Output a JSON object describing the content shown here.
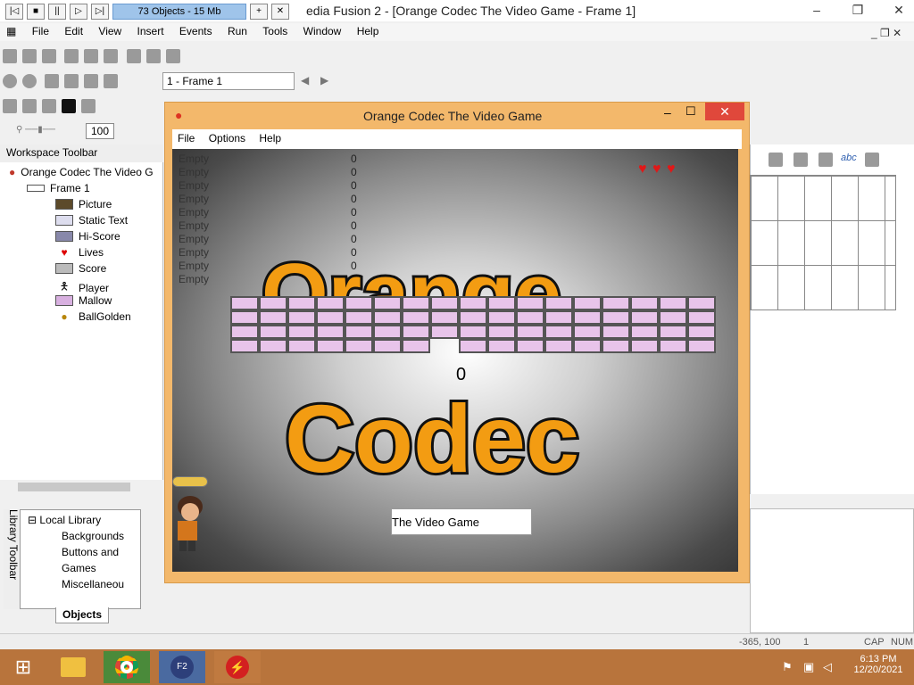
{
  "app": {
    "title_visible": "edia Fusion 2 - [Orange Codec The Video Game - Frame 1]",
    "object_info": "73 Objects - 15 Mb",
    "menu": [
      "File",
      "Edit",
      "View",
      "Insert",
      "Events",
      "Run",
      "Tools",
      "Window",
      "Help"
    ]
  },
  "toolbar": {
    "frame_select": "1 - Frame 1",
    "zoom": "100"
  },
  "workspace": {
    "header": "Workspace Toolbar",
    "root": "Orange Codec The Video G",
    "frame": "Frame 1",
    "items": [
      "Picture",
      "Static Text",
      "Hi-Score",
      "Lives",
      "Score",
      "Player",
      "Mallow",
      "BallGolden"
    ]
  },
  "library": {
    "tab": "Library Toolbar",
    "root": "Local Library",
    "items": [
      "Backgrounds",
      "Buttons and",
      "Games",
      "Miscellaneou"
    ],
    "objects_tab": "Objects"
  },
  "game_window": {
    "title": "Orange Codec The Video Game",
    "menu": [
      "File",
      "Options",
      "Help"
    ],
    "hiscore_names": [
      "Empty",
      "Empty",
      "Empty",
      "Empty",
      "Empty",
      "Empty",
      "Empty",
      "Empty",
      "Empty",
      "Empty"
    ],
    "hiscore_values": [
      "0",
      "0",
      "0",
      "0",
      "0",
      "0",
      "0",
      "0",
      "0",
      "0"
    ],
    "logo_line1": "Orange",
    "logo_line2": "Codec",
    "score": "0",
    "subtitle": "The Video Game",
    "lives": 3
  },
  "statusbar": {
    "coords": "-365, 100",
    "layer": "1",
    "caps": "CAP",
    "num": "NUM"
  },
  "taskbar": {
    "time": "6:13 PM",
    "date": "12/20/2021"
  },
  "colors": {
    "taskbar": "#b8743c",
    "brick": "#e8c4ea",
    "logo_fill": "#f39c12",
    "close": "#e0483b"
  }
}
